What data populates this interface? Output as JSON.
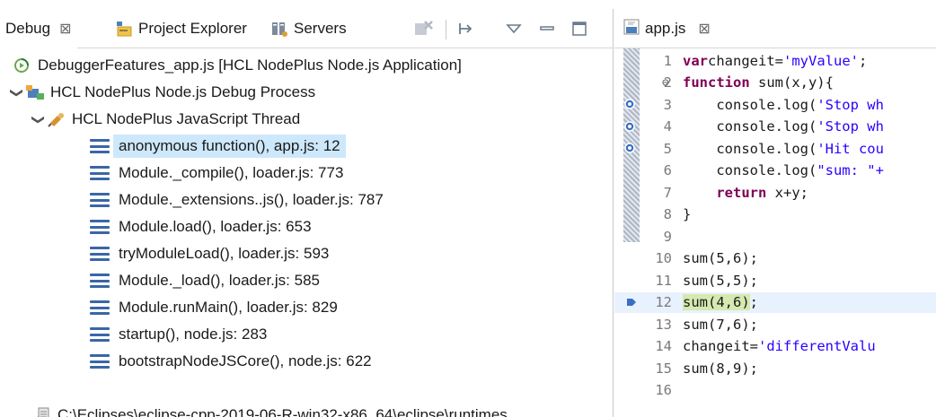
{
  "debug_view": {
    "tabs": [
      {
        "label": "Debug",
        "icon": "debug-tab-icon"
      },
      {
        "label": "Project Explorer",
        "icon": "project-explorer-icon"
      },
      {
        "label": "Servers",
        "icon": "servers-icon"
      }
    ],
    "close_glyph": "⊠",
    "toolbar": [
      "remove-terminated-icon",
      "step-filter-icon",
      "view-menu-icon",
      "minimize-icon",
      "maximize-icon"
    ],
    "tree": {
      "launch": "DebuggerFeatures_app.js [HCL NodePlus Node.js Application]",
      "process": "HCL NodePlus Node.js Debug Process",
      "thread": "HCL NodePlus JavaScript Thread",
      "frames": [
        "anonymous function(), app.js: 12",
        "Module._compile(), loader.js: 773",
        "Module._extensions..js(), loader.js: 787",
        "Module.load(), loader.js: 653",
        "tryModuleLoad(), loader.js: 593",
        "Module._load(), loader.js: 585",
        "Module.runMain(), loader.js: 829",
        "startup(), node.js: 283",
        "bootstrapNodeJSCore(), node.js: 622"
      ],
      "runtime_path": "C:\\Eclipses\\eclipse-cpp-2019-06-R-win32-x86_64\\eclipse\\runtimes"
    }
  },
  "editor": {
    "tab_label": "app.js",
    "close_glyph": "⊠",
    "lines": [
      {
        "n": "1",
        "parts": [
          [
            "kw",
            "var"
          ],
          [
            "",
            "changeit="
          ],
          [
            "str",
            "'myValue'"
          ],
          [
            "",
            ";"
          ]
        ]
      },
      {
        "n": "2",
        "fold": "⊖",
        "parts": [
          [
            "kw",
            "function"
          ],
          [
            "",
            " sum(x,y){"
          ]
        ]
      },
      {
        "n": "3",
        "parts": [
          [
            "",
            "    console.log("
          ],
          [
            "str",
            "'Stop wh"
          ]
        ]
      },
      {
        "n": "4",
        "parts": [
          [
            "",
            "    console.log("
          ],
          [
            "str",
            "'Stop wh"
          ]
        ]
      },
      {
        "n": "5",
        "parts": [
          [
            "",
            "    console.log("
          ],
          [
            "str",
            "'Hit cou"
          ]
        ]
      },
      {
        "n": "6",
        "parts": [
          [
            "",
            "    console.log("
          ],
          [
            "str",
            "\"sum: \"+"
          ]
        ]
      },
      {
        "n": "7",
        "parts": [
          [
            "",
            "    "
          ],
          [
            "kw",
            "return"
          ],
          [
            "",
            " x+y;"
          ]
        ]
      },
      {
        "n": "8",
        "parts": [
          [
            "",
            "}"
          ]
        ]
      },
      {
        "n": "9",
        "parts": []
      },
      {
        "n": "10",
        "parts": [
          [
            "",
            "sum(5,6);"
          ]
        ]
      },
      {
        "n": "11",
        "parts": [
          [
            "",
            "sum(5,5);"
          ]
        ]
      },
      {
        "n": "12",
        "parts": [
          [
            "hl",
            "sum(4,6)"
          ],
          [
            "",
            ";"
          ]
        ]
      },
      {
        "n": "13",
        "parts": [
          [
            "",
            "sum(7,6);"
          ]
        ]
      },
      {
        "n": "14",
        "parts": [
          [
            "",
            "changeit="
          ],
          [
            "str",
            "'differentValu"
          ]
        ]
      },
      {
        "n": "15",
        "parts": [
          [
            "",
            "sum(8,9);"
          ]
        ]
      },
      {
        "n": "16",
        "parts": []
      }
    ],
    "breakpoint_lines": [
      "3",
      "4",
      "5"
    ],
    "current_line": "12"
  }
}
